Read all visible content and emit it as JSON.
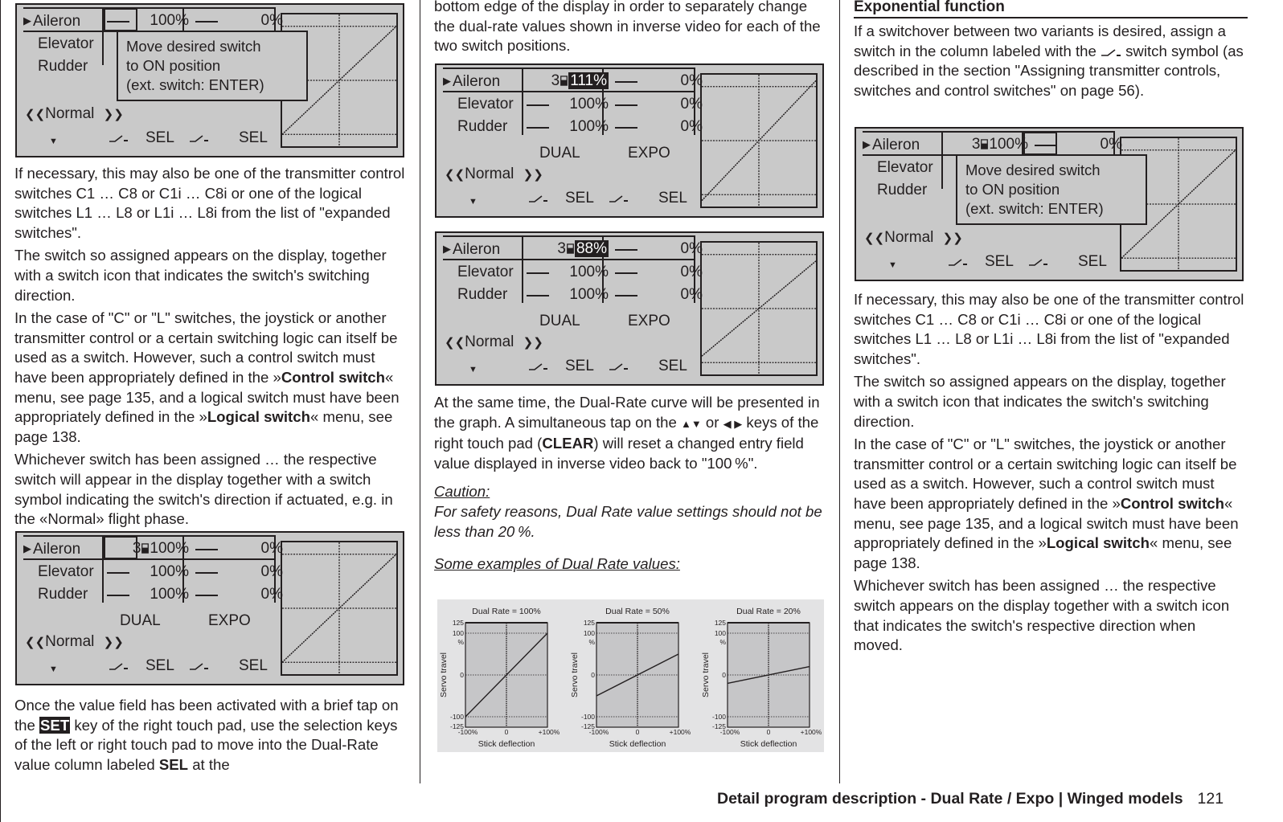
{
  "displays": {
    "common": {
      "rows": [
        "Aileron",
        "Elevator",
        "Rudder"
      ],
      "dual_label": "DUAL",
      "expo_label": "EXPO",
      "phase": "Normal",
      "phase_prev": "«",
      "phase_next": "»",
      "sel_label": "SEL",
      "default_value": "100%",
      "expo_value": "0%"
    },
    "popup": {
      "line1": "Move desired switch",
      "line2": "to  ON  position",
      "line3": "(ext.  switch:  ENTER)"
    },
    "d1": {
      "aileron_switch": "",
      "aileron_dual": "100%",
      "aileron_expo": "0%",
      "selected": "dual-switch"
    },
    "d2": {
      "aileron_switch": "3",
      "aileron_dual": "100%",
      "aileron_expo": "0%",
      "selected": "dual-switch"
    },
    "d3": {
      "aileron_switch": "3",
      "aileron_dual": "111%",
      "aileron_expo": "0%",
      "selected": "dual-value",
      "curve_rate": 1.11
    },
    "d4": {
      "aileron_switch": "3",
      "aileron_dual": "88%",
      "aileron_expo": "0%",
      "selected": "dual-value",
      "curve_rate": 0.88
    },
    "d5": {
      "aileron_switch": "3",
      "aileron_dual": "100%",
      "aileron_expo": "0%",
      "selected": "expo-switch"
    }
  },
  "col1": {
    "p1": "If necessary, this may also be one of the transmitter control switches C1 … C8 or C1i … C8i or one of the logical switches L1 … L8 or L1i … L8i from the list of \"expanded switches\".",
    "p2": "The switch so assigned appears on the display, together with a switch icon that indicates the switch's switching direction.",
    "p3_a": "In the case of \"C\" or \"L\" switches, the joystick or another transmitter control or a certain switching logic can itself be used as a switch. However, such a control switch must have been appropriately defined in the »",
    "p3_b": "Control switch",
    "p3_c": "« menu, see page 135, and a logical switch must have been appropriately defined in the »",
    "p3_d": "Logical switch",
    "p3_e": "« menu, see page 138.",
    "p4": "Whichever switch has been assigned … the respective switch will appear in the display together with a switch symbol indicating the switch's direction if actuated, e.g. in the «Normal» flight phase.",
    "p5_a": "Once the value field has been activated with a brief tap on the ",
    "p5_key": "SET",
    "p5_b": " key of the right touch pad, use the selection keys of the left or right touch pad to move into the Dual-Rate value column labeled ",
    "p5_sel": "SEL",
    "p5_c": " at the"
  },
  "col2": {
    "p1": "bottom edge of the display  in order to separately change the dual-rate values shown in inverse video for each of the two switch positions.",
    "p2_a": "At the same time, the Dual-Rate curve will be presented in the graph. A simultaneous tap on the ",
    "p2_keys1": "▲▼",
    "p2_or": " or ",
    "p2_keys2": "◀ ▶",
    "p2_b": " keys of the right touch pad (",
    "p2_clear": "CLEAR",
    "p2_c": ") will reset a changed entry field value displayed in inverse video back to \"100 %\".",
    "caution_title": "Caution:",
    "caution_text": "For safety reasons, Dual Rate value settings should not be less than 20 %.",
    "examples_title": "Some examples of Dual Rate values:"
  },
  "col3": {
    "heading": "Exponential function",
    "p1_a": "If a switchover between two variants is desired, assign a switch in the column labeled with the ",
    "p1_b": " switch symbol (as described in the section \"Assigning transmitter controls, switches and control switches\" on page 56).",
    "p2": "If necessary, this may also be one of the transmitter control switches C1 … C8 or C1i … C8i or one of the logical switches L1 … L8 or L1i … L8i from the list of \"expanded switches\".",
    "p3": "The switch so assigned appears on the display, together with a switch icon that indicates the switch's switching direction.",
    "p4_a": "In the case of \"C\" or \"L\" switches, the joystick or another transmitter control or a certain switching logic can itself be used as a switch. However, such a control switch must have been appropriately defined in the »",
    "p4_b": "Control switch",
    "p4_c": "« menu, see page 135, and a logical switch must have been appropriately defined in the »",
    "p4_d": "Logical switch",
    "p4_e": "« menu, see page 138.",
    "p5": "Whichever switch has been assigned … the respective switch appears on the display together with a switch icon that indicates the switch's respective direction when moved."
  },
  "footer": {
    "title": "Detail program description - Dual Rate / Expo | Winged models",
    "page": "121"
  },
  "chart_data": [
    {
      "type": "line",
      "title": "Dual Rate = 100%",
      "xlabel": "Stick deflection",
      "ylabel": "Servo travel",
      "x_ticks": [
        "-100%",
        "0",
        "+100%"
      ],
      "y_ticks": [
        "125",
        "100",
        "%",
        "0",
        "-100",
        "-125"
      ],
      "xlim": [
        -100,
        100
      ],
      "ylim": [
        -125,
        125
      ],
      "grid": "dotted at x=0, y=-100, 0, 100",
      "x": [
        -100,
        100
      ],
      "y": [
        -100,
        100
      ]
    },
    {
      "type": "line",
      "title": "Dual Rate = 50%",
      "xlabel": "Stick deflection",
      "ylabel": "Servo travel",
      "x_ticks": [
        "-100%",
        "0",
        "+100%"
      ],
      "y_ticks": [
        "125",
        "100",
        "%",
        "0",
        "-100",
        "-125"
      ],
      "xlim": [
        -100,
        100
      ],
      "ylim": [
        -125,
        125
      ],
      "grid": "dotted at x=0, y=-100, 0, 100",
      "x": [
        -100,
        100
      ],
      "y": [
        -50,
        50
      ]
    },
    {
      "type": "line",
      "title": "Dual Rate = 20%",
      "xlabel": "Stick deflection",
      "ylabel": "Servo travel",
      "x_ticks": [
        "-100%",
        "0",
        "+100%"
      ],
      "y_ticks": [
        "125",
        "100",
        "%",
        "0",
        "-100",
        "-125"
      ],
      "xlim": [
        -100,
        100
      ],
      "ylim": [
        -125,
        125
      ],
      "grid": "dotted at x=0, y=-100, 0, 100",
      "x": [
        -100,
        100
      ],
      "y": [
        -20,
        20
      ]
    }
  ]
}
